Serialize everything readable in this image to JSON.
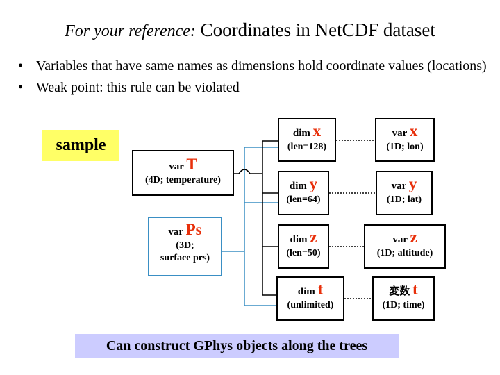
{
  "title": {
    "prefix": "For your reference:",
    "main": "Coordinates in NetCDF dataset"
  },
  "bullets": [
    "Variables that have same names as dimensions hold coordinate values (locations)",
    "Weak point: this rule can be violated"
  ],
  "bullet_glyph": "•",
  "sample_label": "sample",
  "vars_left": {
    "T": {
      "prefix": "var",
      "name": "T",
      "desc": "(4D; temperature)"
    },
    "Ps": {
      "prefix": "var",
      "name": "Ps",
      "desc1": "(3D;",
      "desc2": "surface prs)"
    }
  },
  "dims": [
    {
      "prefix": "dim",
      "name": "x",
      "len": "(len=128)"
    },
    {
      "prefix": "dim",
      "name": "y",
      "len": "(len=64)"
    },
    {
      "prefix": "dim",
      "name": "z",
      "len": "(len=50)"
    },
    {
      "prefix": "dim",
      "name": "t",
      "len": "(unlimited)"
    }
  ],
  "coord_vars": [
    {
      "prefix": "var",
      "name": "x",
      "desc": "(1D; lon)"
    },
    {
      "prefix": "var",
      "name": "y",
      "desc": "(1D; lat)"
    },
    {
      "prefix": "var",
      "name": "z",
      "desc": "(1D; altitude)"
    },
    {
      "prefix": "変数",
      "name": "t",
      "desc": "(1D; time)"
    }
  ],
  "footer": "Can construct GPhys objects along the trees",
  "colors": {
    "accent_red": "#e8300b",
    "sample_bg": "#ffff66",
    "footer_bg": "#ccccff",
    "ps_tree": "#3a8fc4",
    "t_tree": "#000000"
  }
}
